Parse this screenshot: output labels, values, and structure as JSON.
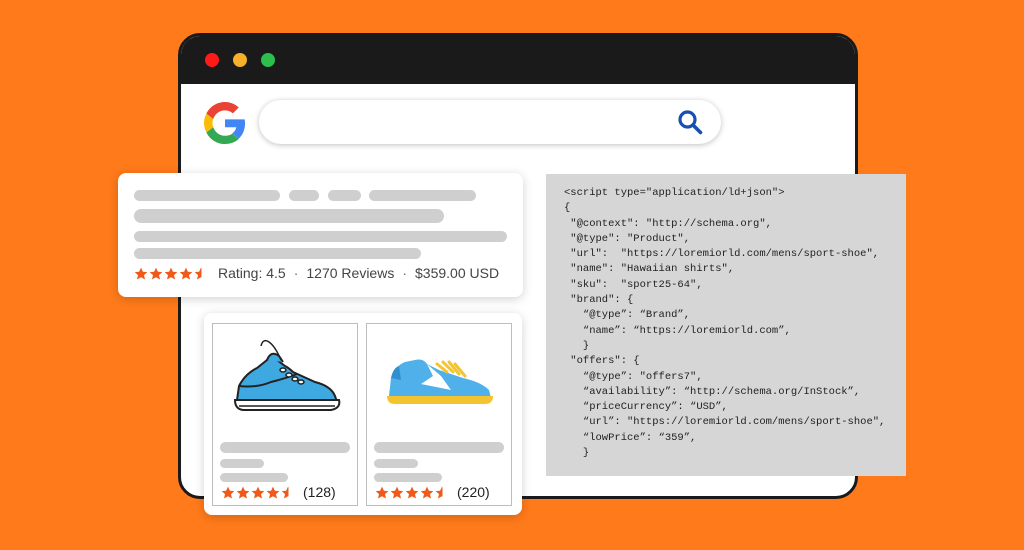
{
  "colors": {
    "background": "#ff7a1a",
    "titlebar": "#1a1a1a",
    "dot_red": "#ff1a1a",
    "dot_yellow": "#f7b02a",
    "dot_green": "#2bbf4e",
    "star": "#f0591a",
    "search_icon": "#1a4fb0",
    "placeholder_bar": "#cfcfcf",
    "code_background": "#d6d6d6"
  },
  "icons": {
    "logo": "google-g-logo",
    "search": "magnifier-icon",
    "star": "star-icon",
    "product_1": "sneaker-white-blue",
    "product_2": "sneaker-blue-yellow"
  },
  "search": {
    "placeholder": "",
    "value": ""
  },
  "result": {
    "stars": 4.5,
    "rating_text": "Rating: 4.5",
    "reviews_text": "1270 Reviews",
    "price_text": "$359.00 USD",
    "separator": "·"
  },
  "products": [
    {
      "stars": 4.5,
      "count_text": "(128)"
    },
    {
      "stars": 4.5,
      "count_text": "(220)"
    }
  ],
  "code_lines": [
    "<script type=\"application/ld+json\">",
    "{",
    " \"@context\": \"http://schema.org\",",
    " \"@type\": \"Product\",",
    " \"url\":  \"https://loremiorld.com/mens/sport-shoe\",",
    " \"name\": \"Hawaiian shirts\",",
    " \"sku\":  \"sport25-64\",",
    " \"brand\": {",
    "   “@type”: “Brand”,",
    "   “name”: “https://loremiorld.com”,",
    "   }",
    " \"offers\": {",
    "   “@type”: \"offers7\",",
    "   “availability”: “http://schema.org/InStock”,",
    "   “priceCurrency”: “USD”,",
    "   “url”: \"https://loremiorld.com/mens/sport-shoe\",",
    "   “lowPrice”: “359”,",
    "   }"
  ]
}
